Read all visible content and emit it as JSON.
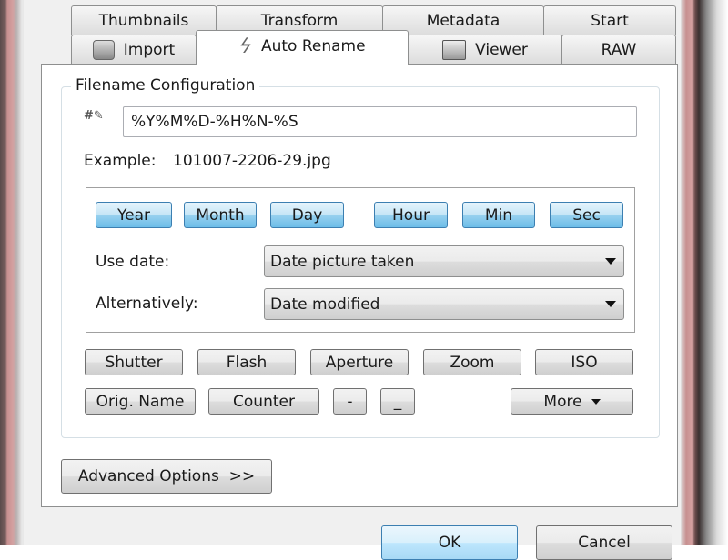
{
  "tabs_row1": [
    {
      "label": "Thumbnails"
    },
    {
      "label": "Transform"
    },
    {
      "label": "Metadata"
    },
    {
      "label": "Start"
    }
  ],
  "tabs_row2": [
    {
      "label": "Import",
      "icon": "camera-icon"
    },
    {
      "label": "Auto Rename",
      "icon": "lightning-icon",
      "selected": true
    },
    {
      "label": "Viewer",
      "icon": "monitor-icon"
    },
    {
      "label": "RAW"
    }
  ],
  "group_title": "Filename Configuration",
  "pattern": "%Y%M%D-%H%N-%S",
  "example_label": "Example:",
  "example_value": "101007-2206-29.jpg",
  "date_buttons": [
    "Year",
    "Month",
    "Day",
    "Hour",
    "Min",
    "Sec"
  ],
  "use_date": {
    "label": "Use date:",
    "value": "Date picture taken"
  },
  "alternatively": {
    "label": "Alternatively:",
    "value": "Date modified"
  },
  "tag_buttons_row1": [
    "Shutter",
    "Flash",
    "Aperture",
    "Zoom",
    "ISO"
  ],
  "tag_buttons_row2": [
    "Orig. Name",
    "Counter",
    "-",
    "_",
    "More"
  ],
  "advanced_label": "Advanced Options  >>",
  "ok_label": "OK",
  "cancel_label": "Cancel",
  "colors": {
    "accent_button": "#98d1ef",
    "frame": "#d4a0a0"
  }
}
